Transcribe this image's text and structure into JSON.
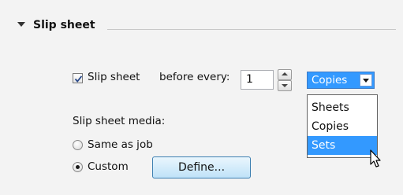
{
  "section": {
    "title": "Slip sheet"
  },
  "slip": {
    "checkbox_label": "Slip sheet",
    "checked": true,
    "before_every_label": "before every:",
    "count": "1",
    "unit_selected": "Copies",
    "unit_options": [
      "Sheets",
      "Copies",
      "Sets"
    ],
    "highlighted_option": "Sets"
  },
  "media": {
    "label": "Slip sheet media:",
    "options": [
      {
        "label": "Same as job",
        "selected": false
      },
      {
        "label": "Custom",
        "selected": true
      }
    ],
    "define_button": "Define..."
  },
  "colors": {
    "accent": "#3399ff",
    "background": "#f3f3f3"
  },
  "icons": {
    "collapse": "triangle-down-icon",
    "checkmark": "checkmark-icon",
    "spin_up": "spin-up-icon",
    "spin_down": "spin-down-icon",
    "dropdown": "chevron-down-icon",
    "cursor": "mouse-pointer-icon"
  }
}
